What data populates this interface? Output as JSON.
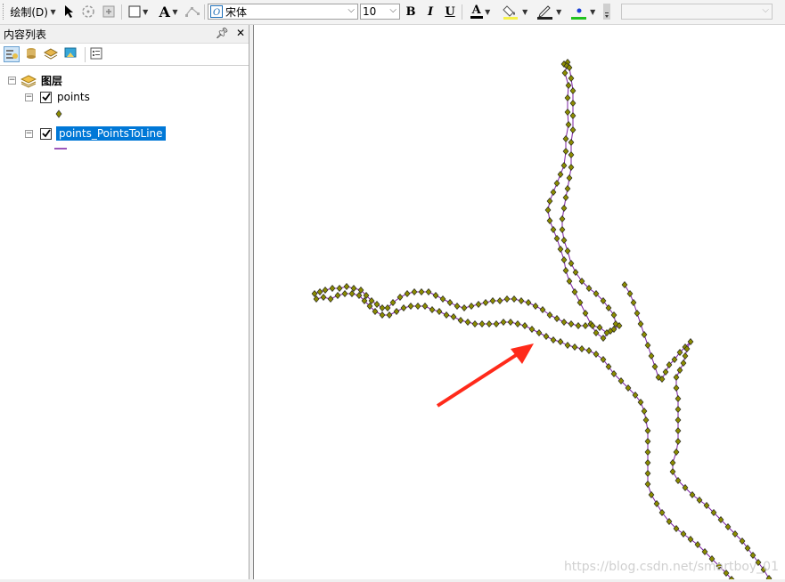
{
  "toolbar": {
    "draw_menu_label": "绘制(D)",
    "font_name": "宋体",
    "font_size": "10",
    "bold_label": "B",
    "italic_label": "I",
    "underline_label": "U",
    "font_color_label": "A",
    "text_tool_label": "A"
  },
  "toc": {
    "title": "内容列表",
    "layers_label": "图层",
    "layers": [
      {
        "name": "points",
        "checked": true
      },
      {
        "name": "points_PointsToLine",
        "checked": true,
        "selected": true
      }
    ]
  },
  "map": {
    "point_color": "#8b8b00",
    "line_color": "#7a1fa2",
    "arrow_color": "#ff2a1a"
  },
  "watermark": "https://blog.csdn.net/smartboy_01"
}
